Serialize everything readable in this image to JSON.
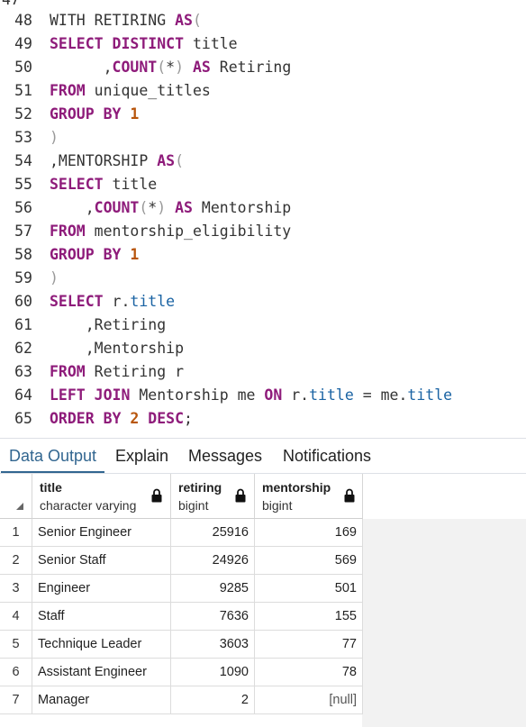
{
  "editor": {
    "lines": [
      {
        "n": "48",
        "tokens": [
          [
            "pl",
            "WITH RETIRING "
          ],
          [
            "kw",
            "AS"
          ],
          [
            "paren",
            "("
          ]
        ]
      },
      {
        "n": "49",
        "tokens": [
          [
            "kw",
            "SELECT DISTINCT"
          ],
          [
            "pl",
            " title"
          ]
        ]
      },
      {
        "n": "50",
        "tokens": [
          [
            "pl",
            "      ,"
          ],
          [
            "kw",
            "COUNT"
          ],
          [
            "paren",
            "("
          ],
          [
            "pl",
            "*"
          ],
          [
            "paren",
            ")"
          ],
          [
            "pl",
            " "
          ],
          [
            "kw",
            "AS"
          ],
          [
            "pl",
            " Retiring"
          ]
        ]
      },
      {
        "n": "51",
        "tokens": [
          [
            "kw",
            "FROM"
          ],
          [
            "pl",
            " unique_titles"
          ]
        ]
      },
      {
        "n": "52",
        "tokens": [
          [
            "kw",
            "GROUP BY"
          ],
          [
            "pl",
            " "
          ],
          [
            "num",
            "1"
          ]
        ]
      },
      {
        "n": "53",
        "tokens": [
          [
            "paren",
            ")"
          ]
        ]
      },
      {
        "n": "54",
        "tokens": [
          [
            "pl",
            ",MENTORSHIP "
          ],
          [
            "kw",
            "AS"
          ],
          [
            "paren",
            "("
          ]
        ]
      },
      {
        "n": "55",
        "tokens": [
          [
            "kw",
            "SELECT"
          ],
          [
            "pl",
            " title"
          ]
        ]
      },
      {
        "n": "56",
        "tokens": [
          [
            "pl",
            "    ,"
          ],
          [
            "kw",
            "COUNT"
          ],
          [
            "paren",
            "("
          ],
          [
            "pl",
            "*"
          ],
          [
            "paren",
            ")"
          ],
          [
            "pl",
            " "
          ],
          [
            "kw",
            "AS"
          ],
          [
            "pl",
            " Mentorship"
          ]
        ]
      },
      {
        "n": "57",
        "tokens": [
          [
            "kw",
            "FROM"
          ],
          [
            "pl",
            " mentorship_eligibility"
          ]
        ]
      },
      {
        "n": "58",
        "tokens": [
          [
            "kw",
            "GROUP BY"
          ],
          [
            "pl",
            " "
          ],
          [
            "num",
            "1"
          ]
        ]
      },
      {
        "n": "59",
        "tokens": [
          [
            "paren",
            ")"
          ]
        ]
      },
      {
        "n": "60",
        "tokens": [
          [
            "kw",
            "SELECT"
          ],
          [
            "pl",
            " r."
          ],
          [
            "cl",
            "title"
          ]
        ]
      },
      {
        "n": "61",
        "tokens": [
          [
            "pl",
            "    ,Retiring"
          ]
        ]
      },
      {
        "n": "62",
        "tokens": [
          [
            "pl",
            "    ,Mentorship"
          ]
        ]
      },
      {
        "n": "63",
        "tokens": [
          [
            "kw",
            "FROM"
          ],
          [
            "pl",
            " Retiring r"
          ]
        ]
      },
      {
        "n": "64",
        "tokens": [
          [
            "kw",
            "LEFT JOIN"
          ],
          [
            "pl",
            " Mentorship me "
          ],
          [
            "kw",
            "ON"
          ],
          [
            "pl",
            " r."
          ],
          [
            "cl",
            "title"
          ],
          [
            "pl",
            " = me."
          ],
          [
            "cl",
            "title"
          ]
        ]
      },
      {
        "n": "65",
        "tokens": [
          [
            "kw",
            "ORDER BY"
          ],
          [
            "pl",
            " "
          ],
          [
            "num",
            "2"
          ],
          [
            "pl",
            " "
          ],
          [
            "kw",
            "DESC"
          ],
          [
            "pl",
            ";"
          ]
        ]
      }
    ]
  },
  "tabs": [
    {
      "label": "Data Output",
      "active": true
    },
    {
      "label": "Explain",
      "active": false
    },
    {
      "label": "Messages",
      "active": false
    },
    {
      "label": "Notifications",
      "active": false
    }
  ],
  "grid": {
    "columns": [
      {
        "name": "title",
        "type": "character varying",
        "icon": "lock-icon"
      },
      {
        "name": "retiring",
        "type": "bigint",
        "icon": "lock-icon"
      },
      {
        "name": "mentorship",
        "type": "bigint",
        "icon": "lock-icon"
      }
    ],
    "rows": [
      {
        "n": "1",
        "title": "Senior Engineer",
        "retiring": "25916",
        "mentorship": "169"
      },
      {
        "n": "2",
        "title": "Senior Staff",
        "retiring": "24926",
        "mentorship": "569"
      },
      {
        "n": "3",
        "title": "Engineer",
        "retiring": "9285",
        "mentorship": "501"
      },
      {
        "n": "4",
        "title": "Staff",
        "retiring": "7636",
        "mentorship": "155"
      },
      {
        "n": "5",
        "title": "Technique Leader",
        "retiring": "3603",
        "mentorship": "77"
      },
      {
        "n": "6",
        "title": "Assistant Engineer",
        "retiring": "1090",
        "mentorship": "78"
      },
      {
        "n": "7",
        "title": "Manager",
        "retiring": "2",
        "mentorship": "[null]"
      }
    ]
  }
}
